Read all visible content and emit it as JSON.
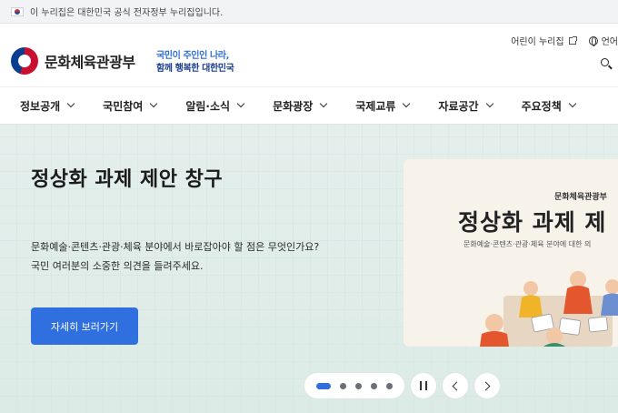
{
  "gov_banner": {
    "text": "이 누리집은 대한민국 공식 전자정부 누리집입니다."
  },
  "header": {
    "logo_text": "문화체육관광부",
    "slogan_line1": "국민이 주인인 나라,",
    "slogan_line2": "함께 행복한 대한민국",
    "kids_link": "어린이 누리집",
    "language_label": "언어"
  },
  "gnb": {
    "items": [
      {
        "label": "정보공개"
      },
      {
        "label": "국민참여"
      },
      {
        "label": "알림·소식"
      },
      {
        "label": "문화광장"
      },
      {
        "label": "국제교류"
      },
      {
        "label": "자료공간"
      },
      {
        "label": "주요정책"
      }
    ]
  },
  "hero": {
    "title": "정상화 과제 제안 창구",
    "desc_line1": "문화예술·콘텐츠·관광·체육 분야에서 바로잡아야 할 점은 무엇인가요?",
    "desc_line2": "국민 여러분의 소중한 의견을 들려주세요.",
    "cta_label": "자세히 보러가기",
    "image": {
      "ministry": "문화체육관광부",
      "title": "정상화 과제 제",
      "subtitle": "문화예술·콘텐츠·관광·체육 분야에 대한 의"
    }
  },
  "carousel": {
    "slide_count": 5,
    "active_index": 0
  },
  "colors": {
    "accent": "#2f6fe0",
    "hero_bg": "#dcebe6",
    "slogan_blue": "#2f6fd6"
  }
}
